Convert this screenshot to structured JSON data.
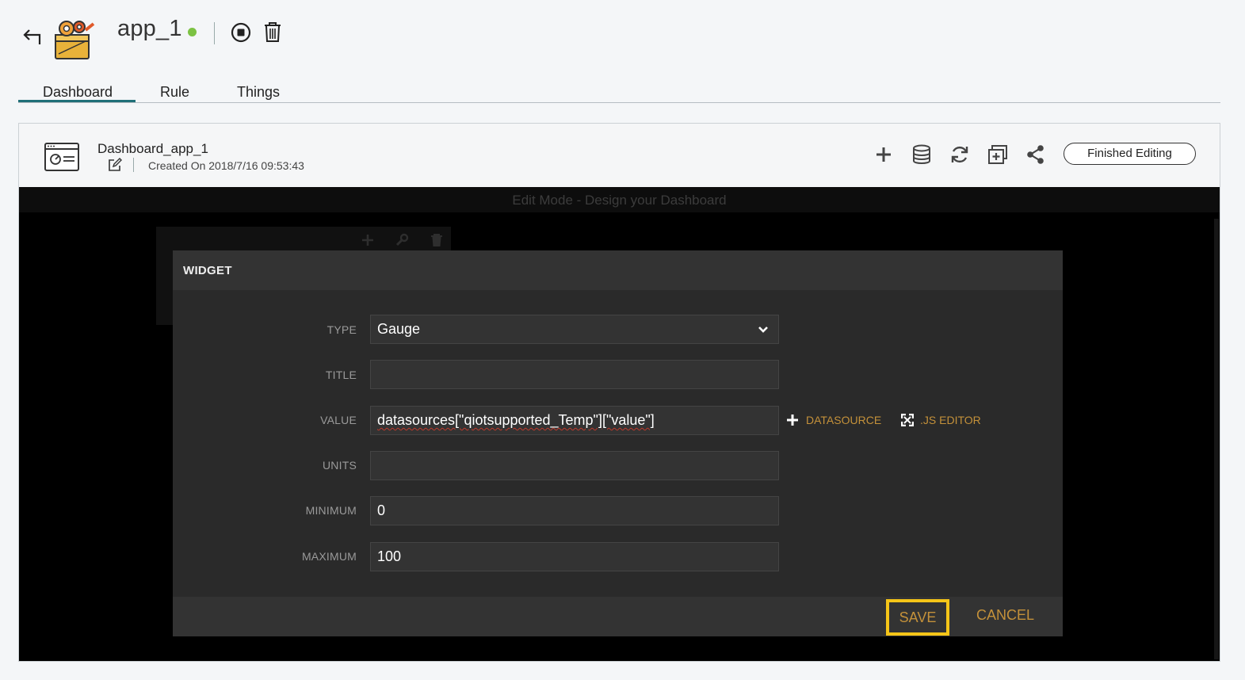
{
  "header": {
    "app_name": "app_1",
    "status": "running",
    "status_color": "#7cc243",
    "icons": [
      "back-arrow-icon",
      "app-toolbox-icon",
      "stop-icon",
      "trash-icon"
    ]
  },
  "tabs": [
    {
      "label": "Dashboard",
      "active": true
    },
    {
      "label": "Rule",
      "active": false
    },
    {
      "label": "Things",
      "active": false
    }
  ],
  "dashboard": {
    "title": "Dashboard_app_1",
    "created": "Created On 2018/7/16 09:53:43",
    "tools": [
      "add-icon",
      "database-icon",
      "refresh-icon",
      "add-pane-icon",
      "share-icon"
    ],
    "finished_label": "Finished Editing"
  },
  "editor": {
    "mode_text": "Edit Mode - Design your Dashboard"
  },
  "modal": {
    "title": "WIDGET",
    "fields": {
      "type": {
        "label": "TYPE",
        "value": "Gauge"
      },
      "title": {
        "label": "TITLE",
        "value": ""
      },
      "value": {
        "label": "VALUE",
        "value": "datasources[\"qiotsupported_Temp\"][\"value\"]"
      },
      "units": {
        "label": "UNITS",
        "value": ""
      },
      "minimum": {
        "label": "MINIMUM",
        "value": "0"
      },
      "maximum": {
        "label": "MAXIMUM",
        "value": "100"
      }
    },
    "datasource_label": "DATASOURCE",
    "js_editor_label": ".JS EDITOR",
    "save_label": "SAVE",
    "cancel_label": "CANCEL",
    "accent_color": "#c4913a",
    "highlight_color": "#f5c518"
  }
}
